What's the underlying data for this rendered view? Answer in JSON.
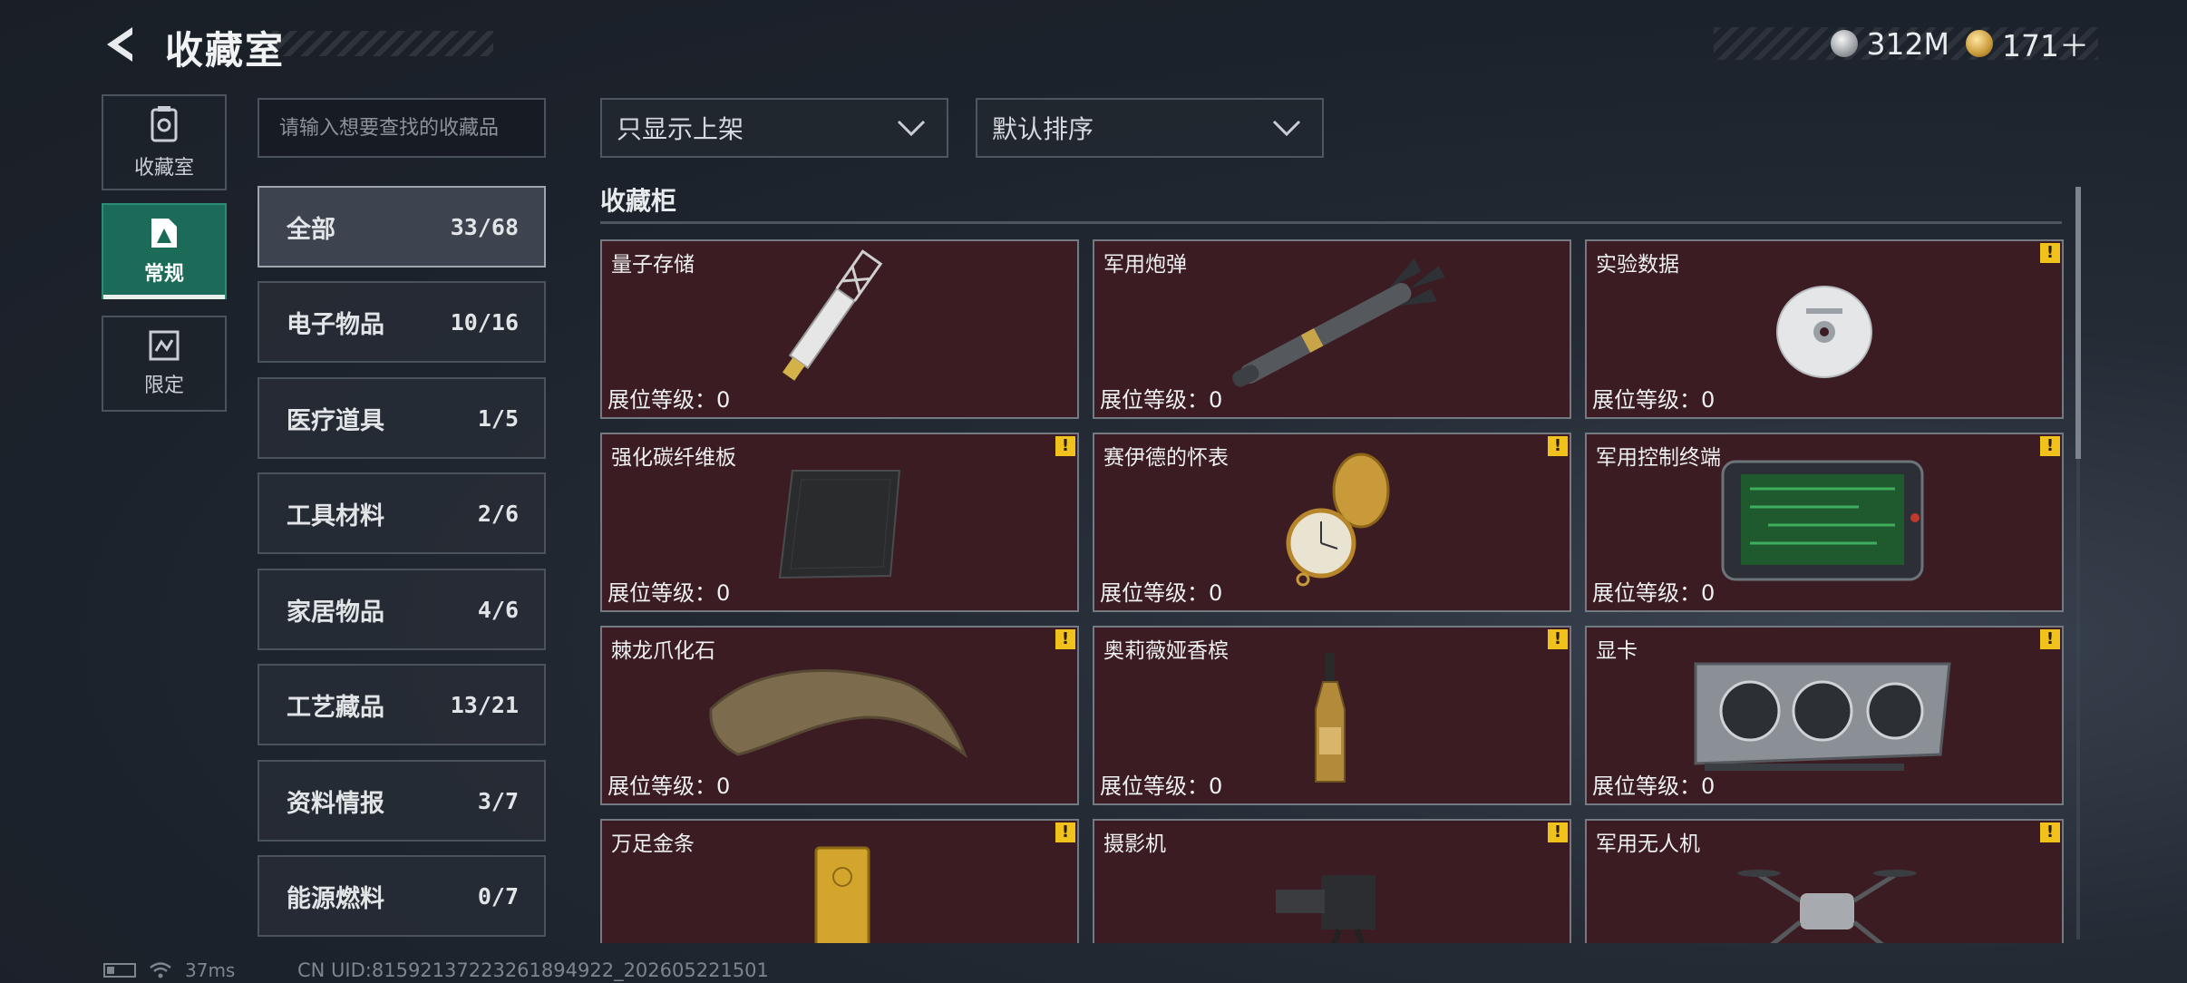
{
  "header": {
    "title": "收藏室"
  },
  "currency": [
    {
      "icon": "silver-coin-icon",
      "value": "312M"
    },
    {
      "icon": "gold-coin-icon",
      "value": "171＋"
    }
  ],
  "nav": [
    {
      "label": "收藏室",
      "icon": "collection-room-icon",
      "active": false
    },
    {
      "label": "常规",
      "icon": "regular-icon",
      "active": true
    },
    {
      "label": "限定",
      "icon": "limited-icon",
      "active": false
    }
  ],
  "search": {
    "placeholder": "请输入想要查找的收藏品"
  },
  "categories": [
    {
      "name": "全部",
      "count": "33/68",
      "active": true
    },
    {
      "name": "电子物品",
      "count": "10/16"
    },
    {
      "name": "医疗道具",
      "count": "1/5"
    },
    {
      "name": "工具材料",
      "count": "2/6"
    },
    {
      "name": "家居物品",
      "count": "4/6"
    },
    {
      "name": "工艺藏品",
      "count": "13/21"
    },
    {
      "name": "资料情报",
      "count": "3/7"
    },
    {
      "name": "能源燃料",
      "count": "0/7"
    }
  ],
  "filters": {
    "display": "只显示上架",
    "sort": "默认排序"
  },
  "section": {
    "title": "收藏柜"
  },
  "items": [
    {
      "name": "量子存储",
      "level": "展位等级：0",
      "warning": false,
      "icon": "usb-drive-icon"
    },
    {
      "name": "军用炮弹",
      "level": "展位等级：0",
      "warning": false,
      "icon": "missile-icon"
    },
    {
      "name": "实验数据",
      "level": "展位等级：0",
      "warning": true,
      "icon": "disc-icon"
    },
    {
      "name": "强化碳纤维板",
      "level": "展位等级：0",
      "warning": true,
      "icon": "carbon-plate-icon"
    },
    {
      "name": "赛伊德的怀表",
      "level": "展位等级：0",
      "warning": true,
      "icon": "pocket-watch-icon"
    },
    {
      "name": "军用控制终端",
      "level": "展位等级：0",
      "warning": true,
      "icon": "terminal-icon"
    },
    {
      "name": "棘龙爪化石",
      "level": "展位等级：0",
      "warning": true,
      "icon": "claw-fossil-icon"
    },
    {
      "name": "奥莉薇娅香槟",
      "level": "展位等级：0",
      "warning": true,
      "icon": "champagne-icon"
    },
    {
      "name": "显卡",
      "level": "展位等级：0",
      "warning": true,
      "icon": "graphics-card-icon"
    },
    {
      "name": "万足金条",
      "level": "",
      "warning": true,
      "icon": "gold-bar-icon"
    },
    {
      "name": "摄影机",
      "level": "",
      "warning": true,
      "icon": "camera-icon"
    },
    {
      "name": "军用无人机",
      "level": "",
      "warning": true,
      "icon": "drone-icon"
    }
  ],
  "status": {
    "ping": "37ms",
    "uid": "CN UID:81592137223261894922_202605221501"
  },
  "colors": {
    "accent": "#1b6b58",
    "card_bg": "#3b1c22",
    "warning": "#f2c21c"
  }
}
